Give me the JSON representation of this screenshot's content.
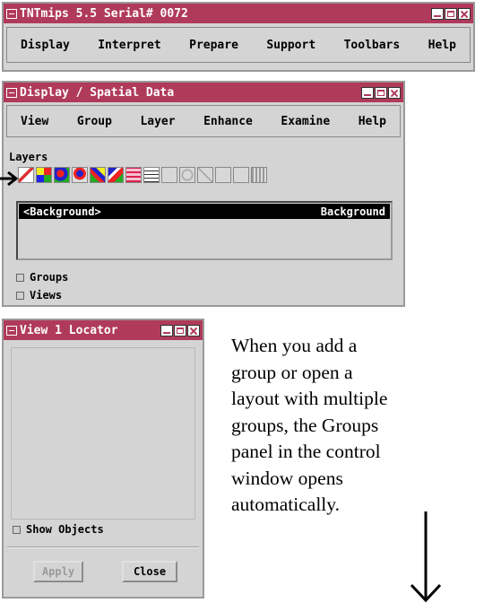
{
  "main_window": {
    "title": "TNTmips 5.5  Serial# 0072",
    "menu": [
      "Display",
      "Interpret",
      "Prepare",
      "Support",
      "Toolbars",
      "Help"
    ]
  },
  "display_window": {
    "title": "Display / Spatial Data",
    "menu": [
      "View",
      "Group",
      "Layer",
      "Enhance",
      "Examine",
      "Help"
    ],
    "layers_label": "Layers",
    "toolbar_icons": [
      "add-layer-icon",
      "raster-layer-icon",
      "vector-layer-icon",
      "shape-layer-icon",
      "cad-layer-icon",
      "tin-layer-icon",
      "database-layer-icon",
      "text-layer-icon",
      "move-layer-icon",
      "remove-layer-icon",
      "delete-layer-icon",
      "raise-layer-icon",
      "lower-layer-icon",
      "layer-controls-icon"
    ],
    "layer_row": {
      "name": "<Background>",
      "type": "Background"
    },
    "groups_label": "Groups",
    "views_label": "Views"
  },
  "locator_window": {
    "title": "View 1 Locator",
    "show_objects_label": "Show Objects",
    "apply_label": "Apply",
    "close_label": "Close"
  },
  "annotation": {
    "text_lines": [
      "When you add a",
      "group or open a",
      "layout with multiple",
      "groups, the Groups",
      "panel in the control",
      "window opens",
      "automatically."
    ]
  },
  "colors": {
    "titlebar": "#b03a5a",
    "window_bg": "#d4d4d4"
  }
}
